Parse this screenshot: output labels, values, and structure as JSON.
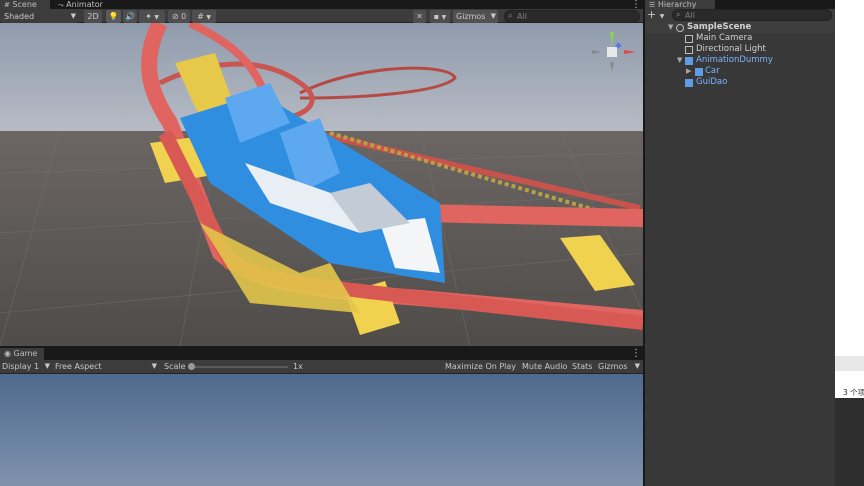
{
  "scene_tabs": {
    "scene": "Scene",
    "animator": "Animator"
  },
  "scene_toolbar": {
    "shading": "Shaded",
    "mode_2d": "2D",
    "hidden_count": "0",
    "gizmos": "Gizmos",
    "search_placeholder": "All"
  },
  "game_tab": {
    "label": "Game"
  },
  "game_toolbar": {
    "display": "Display 1",
    "aspect": "Free Aspect",
    "scale_label": "Scale",
    "scale_value": "1x",
    "scale_level": 0,
    "maximize": "Maximize On Play",
    "mute": "Mute Audio",
    "stats": "Stats",
    "gizmos": "Gizmos"
  },
  "hierarchy": {
    "title": "Hierarchy",
    "search_placeholder": "All",
    "add_label": "+",
    "items": [
      {
        "label": "SampleScene",
        "kind": "scene",
        "blue": false
      },
      {
        "label": "Main Camera",
        "kind": "gameobject",
        "blue": false
      },
      {
        "label": "Directional Light",
        "kind": "gameobject",
        "blue": false
      },
      {
        "label": "AnimationDummy",
        "kind": "prefab",
        "blue": true
      },
      {
        "label": "Car",
        "kind": "prefab-child",
        "blue": true
      },
      {
        "label": "GuiDao",
        "kind": "prefab",
        "blue": true
      }
    ]
  },
  "side_panel": {
    "status": "3 个项"
  },
  "colors": {
    "panel_bg": "#383838",
    "toolbar_bg": "#3c3c3c",
    "prefab_blue": "#7bb3ff",
    "track_red": "#e0645f",
    "track_yellow": "#f1d24f",
    "car_blue": "#2f8ee0"
  },
  "icons": [
    "audio-icon",
    "lightbulb-icon",
    "effects-icon",
    "visibility-icon",
    "gizmo-tools-icon",
    "camera-icon",
    "search-icon",
    "add-icon",
    "kebab-icon",
    "scene-unity-icon",
    "gameobject-cube-icon",
    "prefab-cube-icon",
    "scene-gizmo-icon"
  ]
}
